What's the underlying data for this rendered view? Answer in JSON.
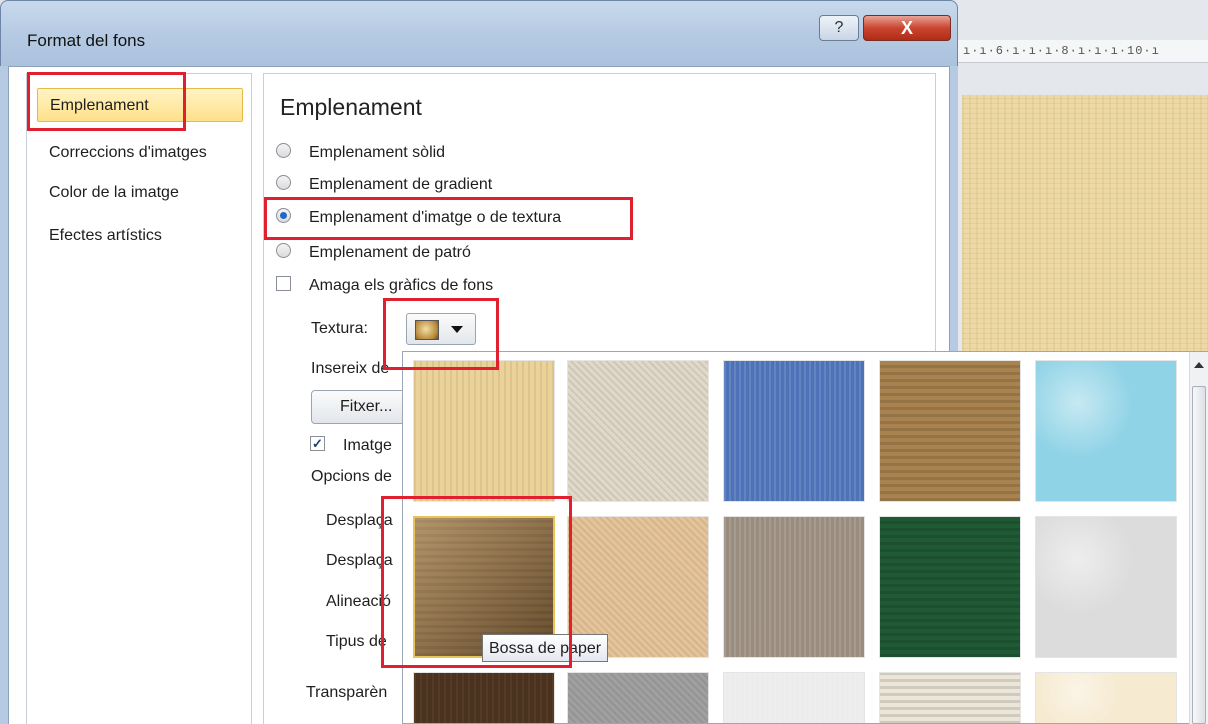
{
  "window": {
    "title": "Format del fons",
    "help_label": "?",
    "close_label": "X"
  },
  "ruler": {
    "text": "ı·ı·6·ı·ı·ı·8·ı·ı·ı·10·ı"
  },
  "sidebar": {
    "items": [
      {
        "label": "Emplenament",
        "selected": true
      },
      {
        "label": "Correccions d'imatges",
        "selected": false
      },
      {
        "label": "Color de la imatge",
        "selected": false
      },
      {
        "label": "Efectes artístics",
        "selected": false
      }
    ]
  },
  "fill": {
    "heading": "Emplenament",
    "options": [
      {
        "label": "Emplenament sòlid",
        "checked": false
      },
      {
        "label": "Emplenament de gradient",
        "checked": false
      },
      {
        "label": "Emplenament d'imatge o de textura",
        "checked": true
      },
      {
        "label": "Emplenament de patró",
        "checked": false
      }
    ],
    "hide_graphics_label": "Amaga els gràfics de fons",
    "hide_graphics_checked": false,
    "texture_label": "Textura:",
    "insert_label": "Insereix de",
    "file_button_label": "Fitxer...",
    "tile_checkbox_label": "Imatge",
    "tile_checked": true,
    "tile_options_label": "Opcions de",
    "offset_x_label": "Desplaça",
    "offset_y_label": "Desplaça",
    "alignment_label": "Alineació",
    "mirror_label": "Tipus de",
    "transparency_label": "Transparèn"
  },
  "gallery": {
    "tooltip": "Bossa de paper",
    "textures": [
      {
        "name": "papyrus",
        "color": "#ead39a"
      },
      {
        "name": "canvas",
        "color": "#e0d8c8"
      },
      {
        "name": "denim",
        "color": "#4d72b8"
      },
      {
        "name": "woven-mat",
        "color": "#a8834f"
      },
      {
        "name": "water-droplets",
        "color": "#8fd3e6"
      },
      {
        "name": "paper-bag",
        "color": "#8b6a42"
      },
      {
        "name": "fish-fossil",
        "color": "#e6c49a"
      },
      {
        "name": "sand",
        "color": "#9a8d7f"
      },
      {
        "name": "green-marble",
        "color": "#1f5a35"
      },
      {
        "name": "white-marble",
        "color": "#dcdcdc"
      },
      {
        "name": "brown-marble",
        "color": "#4a3220"
      },
      {
        "name": "granite",
        "color": "#a0a0a0"
      },
      {
        "name": "stationery",
        "color": "#ececec"
      },
      {
        "name": "recycled-paper",
        "color": "#ece6d8"
      },
      {
        "name": "parchment",
        "color": "#f6ead0"
      }
    ]
  }
}
